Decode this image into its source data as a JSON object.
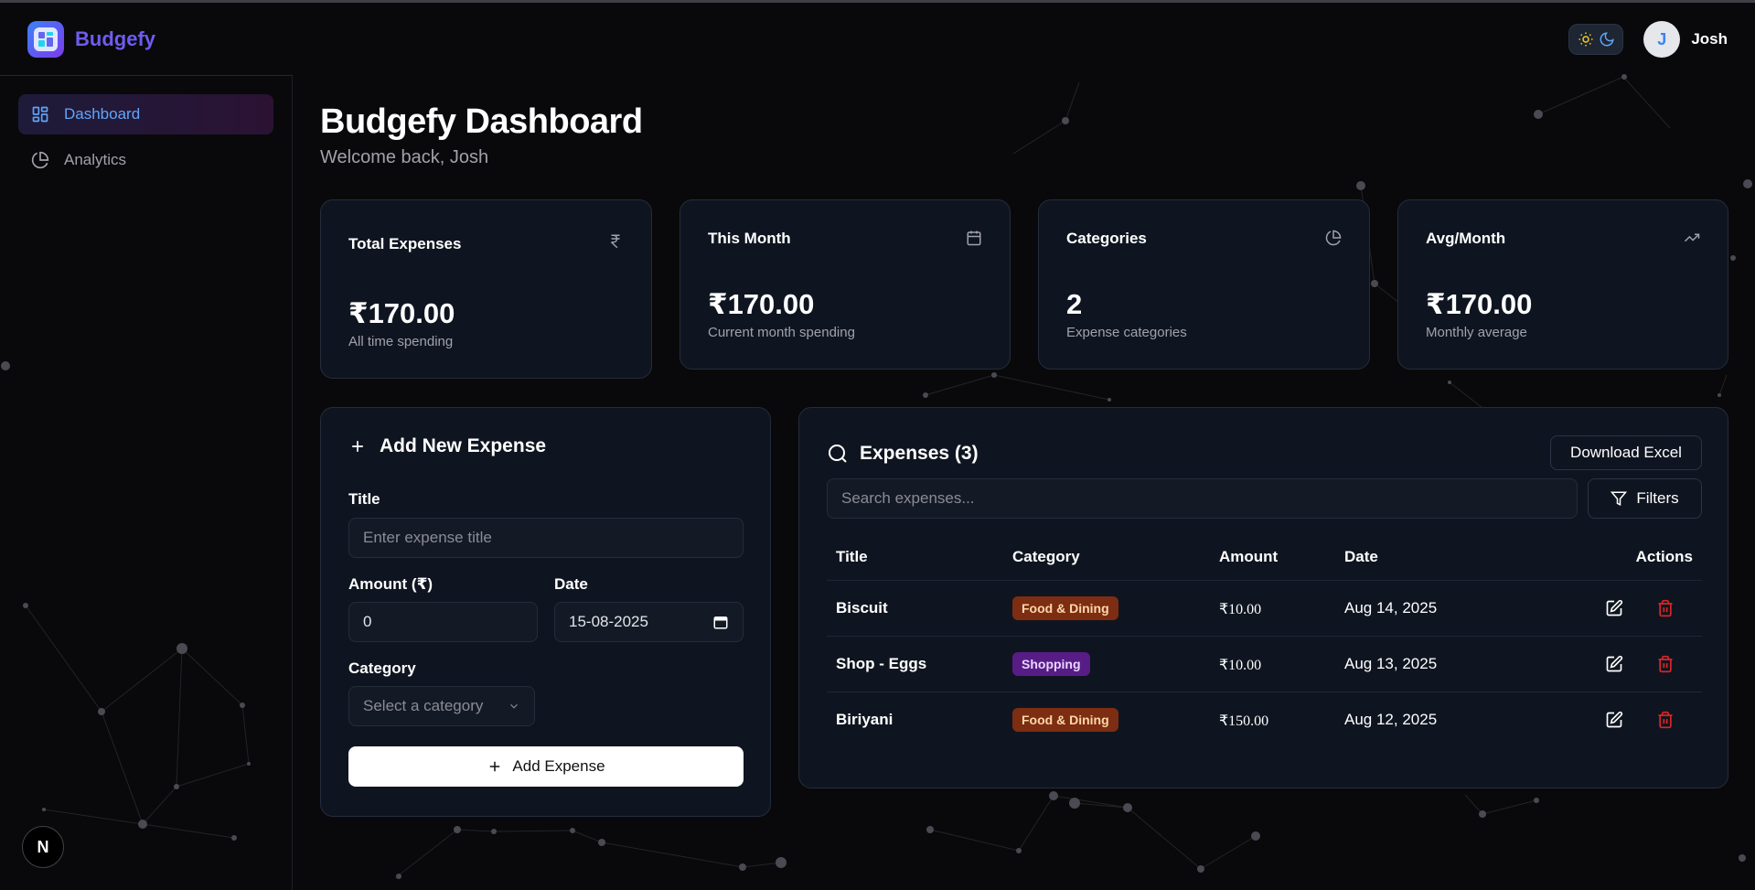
{
  "app": {
    "name": "Budgefy"
  },
  "user": {
    "initial": "J",
    "name": "Josh"
  },
  "sidebar": {
    "items": [
      {
        "label": "Dashboard",
        "icon": "grid-icon",
        "active": true
      },
      {
        "label": "Analytics",
        "icon": "pie-chart-icon",
        "active": false
      }
    ],
    "bottom_badge": "N"
  },
  "header": {
    "title": "Budgefy Dashboard",
    "subtitle": "Welcome back, Josh"
  },
  "stats": [
    {
      "title": "Total Expenses",
      "value": "₹170.00",
      "sub": "All time spending",
      "icon": "rupee-icon"
    },
    {
      "title": "This Month",
      "value": "₹170.00",
      "sub": "Current month spending",
      "icon": "calendar-icon"
    },
    {
      "title": "Categories",
      "value": "2",
      "sub": "Expense categories",
      "icon": "pie-chart-icon"
    },
    {
      "title": "Avg/Month",
      "value": "₹170.00",
      "sub": "Monthly average",
      "icon": "trending-up-icon"
    }
  ],
  "form": {
    "title": "Add New Expense",
    "title_label": "Title",
    "title_placeholder": "Enter expense title",
    "amount_label": "Amount (₹)",
    "amount_value": "0",
    "date_label": "Date",
    "date_value": "15-08-2025",
    "category_label": "Category",
    "category_placeholder": "Select a category",
    "submit_label": "Add Expense"
  },
  "expenses": {
    "title": "Expenses (3)",
    "download_label": "Download Excel",
    "search_placeholder": "Search expenses...",
    "filters_label": "Filters",
    "columns": [
      "Title",
      "Category",
      "Amount",
      "Date",
      "Actions"
    ],
    "rows": [
      {
        "title": "Biscuit",
        "category": "Food & Dining",
        "amount": "₹10.00",
        "date": "Aug 14, 2025"
      },
      {
        "title": "Shop - Eggs",
        "category": "Shopping",
        "amount": "₹10.00",
        "date": "Aug 13, 2025"
      },
      {
        "title": "Biriyani",
        "category": "Food & Dining",
        "amount": "₹150.00",
        "date": "Aug 12, 2025"
      }
    ]
  },
  "colors": {
    "accent": "#60a5fa",
    "brand": "#6d5cf0",
    "food_tag": "#7c2d12",
    "shopping_tag": "#581c87",
    "delete": "#dc2626"
  }
}
